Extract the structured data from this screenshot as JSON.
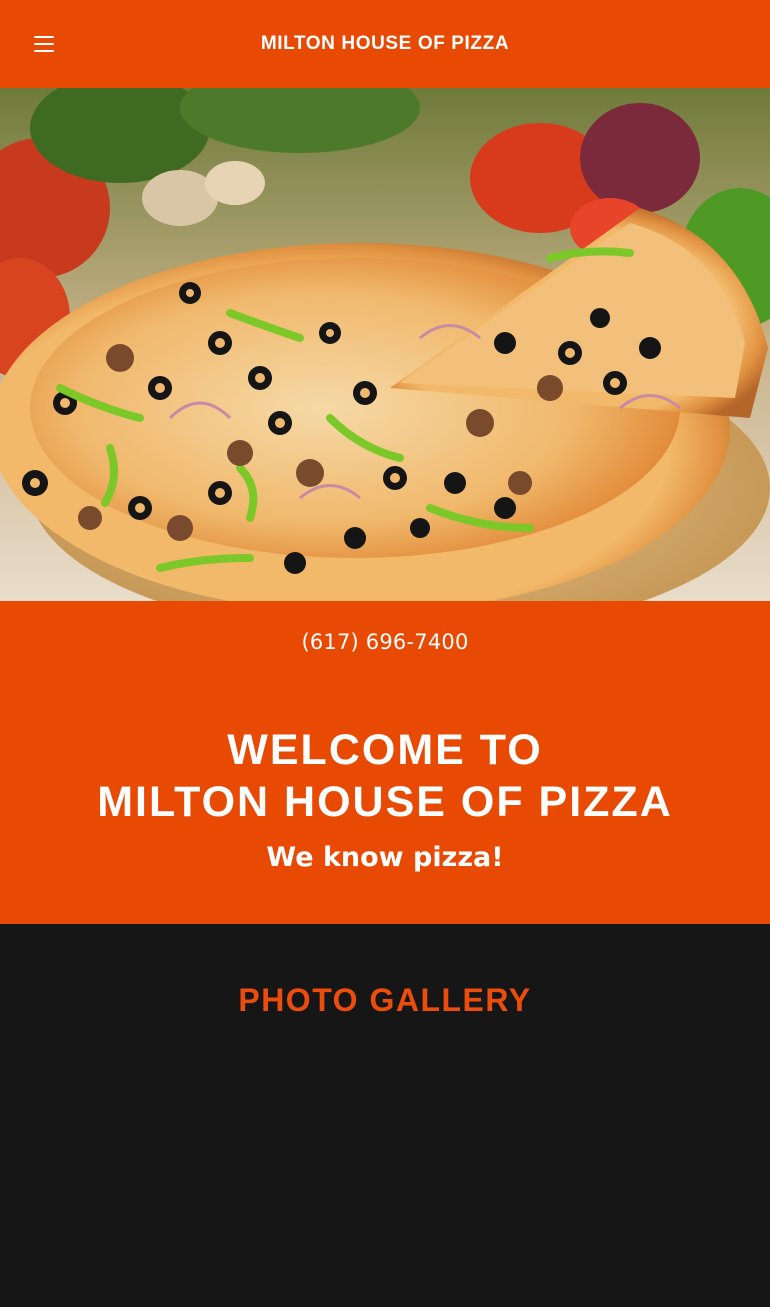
{
  "header": {
    "site_title": "MILTON HOUSE OF PIZZA",
    "menu_icon": "hamburger-menu-icon"
  },
  "hero": {
    "image": "pizza-hero-image"
  },
  "contact": {
    "phone": "(617) 696-7400"
  },
  "welcome": {
    "heading_line1": "WELCOME TO",
    "heading_line2": "MILTON HOUSE OF PIZZA",
    "tagline": "We know pizza!"
  },
  "gallery": {
    "title": "PHOTO GALLERY"
  },
  "colors": {
    "brand": "#e84a03",
    "dark": "#161616",
    "accent_text": "#ec4d0c"
  }
}
